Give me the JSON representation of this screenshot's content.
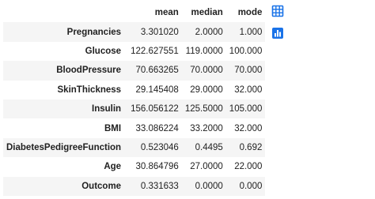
{
  "table": {
    "columns": [
      "mean",
      "median",
      "mode"
    ],
    "rows": [
      {
        "label": "Pregnancies",
        "mean": "3.301020",
        "median": "2.0000",
        "mode": "1.000"
      },
      {
        "label": "Glucose",
        "mean": "122.627551",
        "median": "119.0000",
        "mode": "100.000"
      },
      {
        "label": "BloodPressure",
        "mean": "70.663265",
        "median": "70.0000",
        "mode": "70.000"
      },
      {
        "label": "SkinThickness",
        "mean": "29.145408",
        "median": "29.0000",
        "mode": "32.000"
      },
      {
        "label": "Insulin",
        "mean": "156.056122",
        "median": "125.5000",
        "mode": "105.000"
      },
      {
        "label": "BMI",
        "mean": "33.086224",
        "median": "33.2000",
        "mode": "32.000"
      },
      {
        "label": "DiabetesPedigreeFunction",
        "mean": "0.523046",
        "median": "0.4495",
        "mode": "0.692"
      },
      {
        "label": "Age",
        "mean": "30.864796",
        "median": "27.0000",
        "mode": "22.000"
      },
      {
        "label": "Outcome",
        "mean": "0.331633",
        "median": "0.0000",
        "mode": "0.000"
      }
    ]
  },
  "toolbar": {
    "table_icon": "table-view-icon",
    "chart_icon": "chart-suggest-icon",
    "icon_color": "#1a73e8"
  }
}
